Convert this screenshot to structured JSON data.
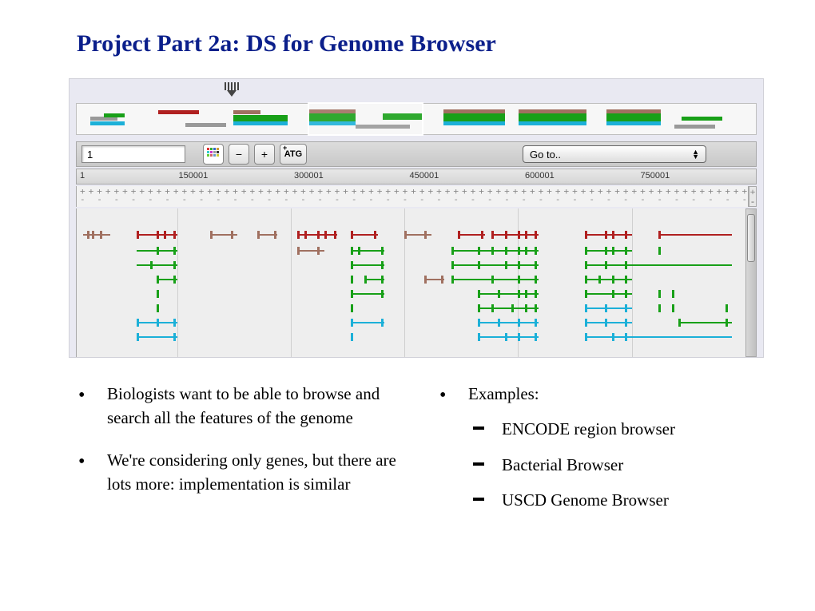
{
  "title": "Project Part 2a: DS for Genome Browser",
  "toolbar": {
    "chromosome_value": "1",
    "zoom_out_label": "−",
    "zoom_in_label": "+",
    "atg_label": "ATG",
    "goto_label": "Go to.."
  },
  "ruler": {
    "start_label": "1",
    "ticks": [
      "150001",
      "300001",
      "450001",
      "600001",
      "750001"
    ]
  },
  "left_bullets": [
    "Biologists want to be able to browse and search all the features of the genome",
    "We're considering only genes, but there are lots more: implementation is similar"
  ],
  "right_heading": "Examples:",
  "right_sub": [
    "ENCODE region browser",
    "Bacterial Browser",
    "USCD Genome Browser"
  ]
}
